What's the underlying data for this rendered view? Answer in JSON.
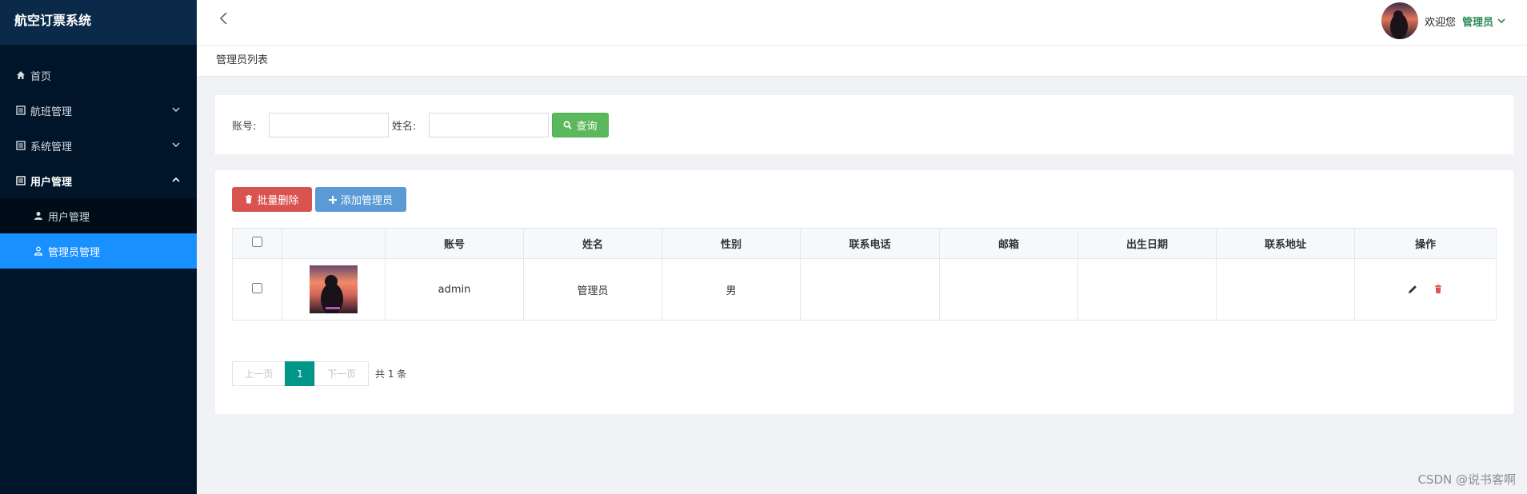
{
  "app": {
    "title": "航空订票系统"
  },
  "sidebar": {
    "items": [
      {
        "label": "首页",
        "icon": "home-icon"
      },
      {
        "label": "航班管理",
        "icon": "list-icon",
        "chevron": "down"
      },
      {
        "label": "系统管理",
        "icon": "list-icon",
        "chevron": "down"
      },
      {
        "label": "用户管理",
        "icon": "list-icon",
        "chevron": "up"
      }
    ],
    "sub_items": [
      {
        "label": "用户管理",
        "icon": "user-icon"
      },
      {
        "label": "管理员管理",
        "icon": "user-outline-icon",
        "active": true
      }
    ]
  },
  "header": {
    "welcome": "欢迎您",
    "username": "管理员"
  },
  "breadcrumb": "管理员列表",
  "search": {
    "account_label": "账号:",
    "account_value": "",
    "name_label": "姓名:",
    "name_value": "",
    "query_button": "查询"
  },
  "toolbar": {
    "batch_delete": "批量删除",
    "add_admin": "添加管理员"
  },
  "table": {
    "columns": [
      "",
      "",
      "账号",
      "姓名",
      "性别",
      "联系电话",
      "邮箱",
      "出生日期",
      "联系地址",
      "操作"
    ],
    "rows": [
      {
        "account": "admin",
        "name": "管理员",
        "gender": "男",
        "phone": "",
        "email": "",
        "birth": "",
        "address": ""
      }
    ]
  },
  "pagination": {
    "prev": "上一页",
    "current": "1",
    "next": "下一页",
    "total": "共 1 条"
  },
  "watermark": "CSDN @说书客啊",
  "colors": {
    "sidebar_bg": "#001529",
    "active_item": "#1890ff",
    "query_btn": "#5cb85c",
    "delete_btn": "#d9534f",
    "add_btn": "#5b9bd5",
    "page_current": "#009688"
  }
}
